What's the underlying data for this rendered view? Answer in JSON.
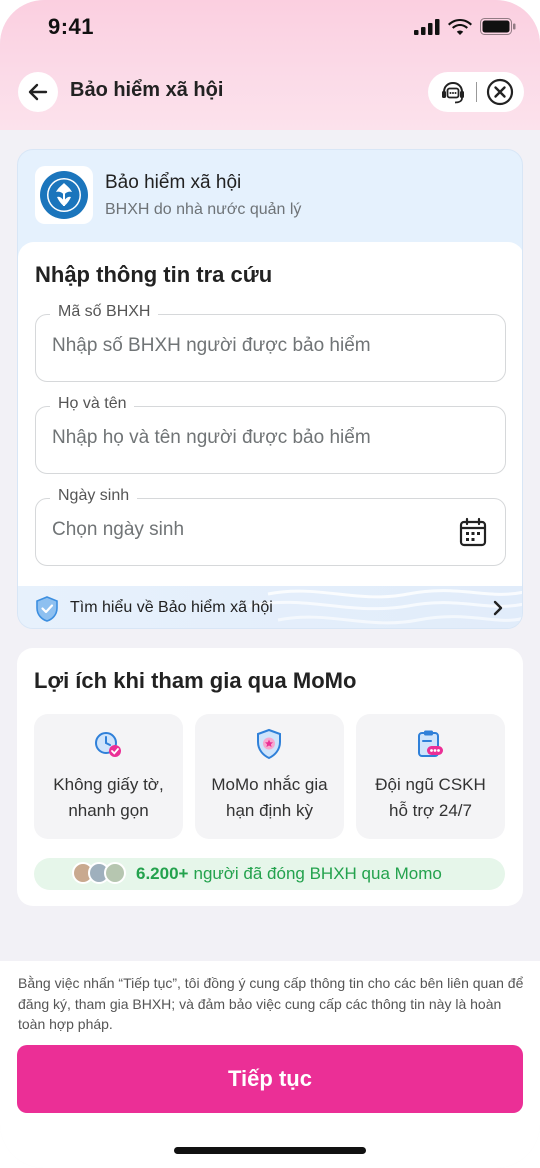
{
  "status_bar": {
    "time": "9:41"
  },
  "header": {
    "title": "Bảo hiểm xã hội",
    "back_icon": "arrow-left-icon",
    "support_icon": "headset-chat-icon",
    "close_icon": "close-circle-icon"
  },
  "provider": {
    "name": "Bảo hiểm xã hội",
    "subtitle": "BHXH do nhà nước quản lý"
  },
  "form": {
    "title": "Nhập thông tin tra cứu",
    "fields": [
      {
        "label": "Mã số BHXH",
        "placeholder": "Nhập số BHXH người được bảo hiểm",
        "value": ""
      },
      {
        "label": "Họ và tên",
        "placeholder": "Nhập họ và tên người được bảo hiểm",
        "value": ""
      },
      {
        "label": "Ngày sinh",
        "placeholder": "Chọn ngày sinh",
        "value": ""
      }
    ]
  },
  "learn_more": {
    "label": "Tìm hiểu về Bảo hiểm xã hội"
  },
  "benefits": {
    "title": "Lợi ích khi tham gia qua MoMo",
    "items": [
      {
        "line1": "Không giấy tờ,",
        "line2": "nhanh gọn",
        "icon": "clock-check-icon"
      },
      {
        "line1": "MoMo nhắc gia",
        "line2": "hạn định kỳ",
        "icon": "shield-reminder-icon"
      },
      {
        "line1": "Đội ngũ CSKH",
        "line2": "hỗ trợ 24/7",
        "icon": "clipboard-support-icon"
      }
    ]
  },
  "stats": {
    "count": "6.200+",
    "text": "người đã đóng BHXH qua Momo"
  },
  "footer": {
    "consent": "Bằng việc nhấn “Tiếp tục”, tôi đồng ý cung cấp thông tin cho các bên liên quan để đăng ký, tham gia BHXH; và đảm bảo việc cung cấp các thông tin này là hoàn toàn hợp pháp.",
    "cta_label": "Tiếp tục"
  },
  "colors": {
    "brand_pink": "#eb2f96",
    "success_green": "#23a24d",
    "info_blue": "#e5f1fd"
  }
}
